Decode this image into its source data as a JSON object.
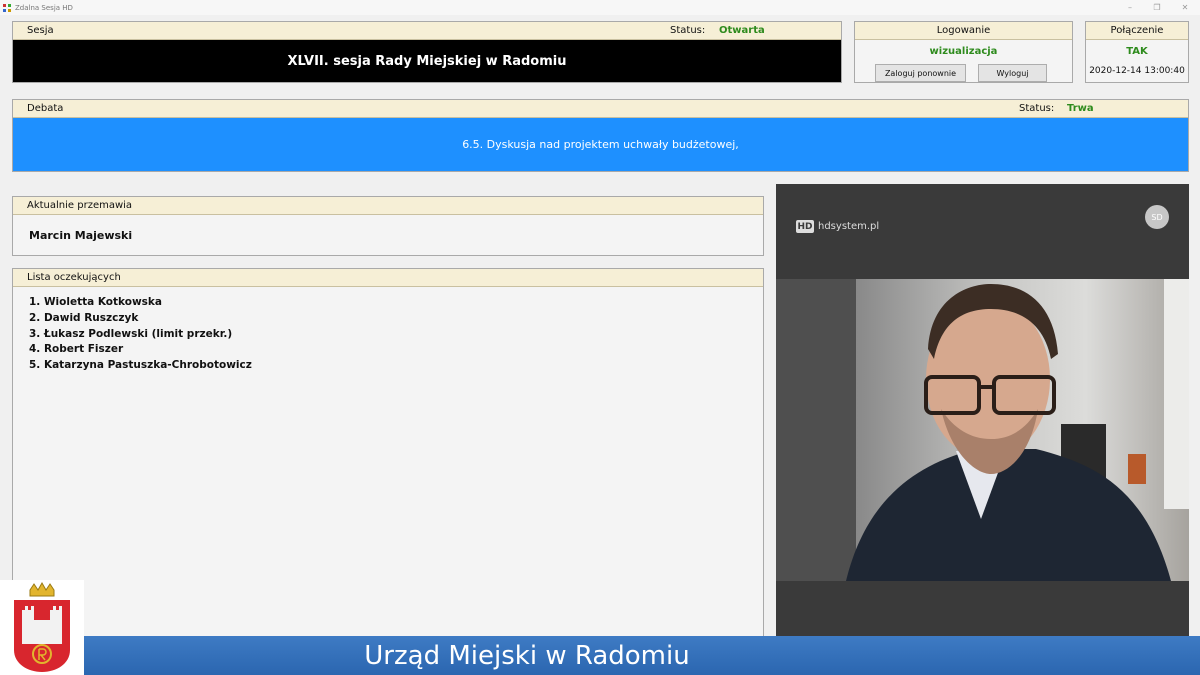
{
  "window": {
    "title": "Zdalna Sesja HD"
  },
  "session": {
    "header_label": "Sesja",
    "status_label": "Status:",
    "status_value": "Otwarta",
    "title": "XLVII. sesja Rady Miejskiej w Radomiu"
  },
  "login": {
    "header_label": "Logowanie",
    "user": "wizualizacja",
    "relogin_label": "Zaloguj ponownie",
    "logout_label": "Wyloguj"
  },
  "connection": {
    "header_label": "Połączenie",
    "state": "TAK",
    "timestamp": "2020-12-14 13:00:40"
  },
  "debate": {
    "header_label": "Debata",
    "status_label": "Status:",
    "status_value": "Trwa",
    "topic": "6.5. Dyskusja nad projektem uchwały budżetowej,"
  },
  "current_speaker": {
    "header_label": "Aktualnie przemawia",
    "name": "Marcin Majewski"
  },
  "queue": {
    "header_label": "Lista oczekujących",
    "items": [
      "1. Wioletta Kotkowska",
      "2. Dawid Ruszczyk",
      "3. Łukasz Podlewski (limit przekr.)",
      "4. Robert Fiszer",
      "5. Katarzyna Pastuszka-Chrobotowicz"
    ]
  },
  "video": {
    "brand": "hdsystem.pl",
    "brand_mark": "HD",
    "avatar_initials": "SD"
  },
  "footer": {
    "text": "Urząd Miejski w Radomiu"
  },
  "colors": {
    "header_bg": "#f6efd6",
    "status_green": "#2e8b1d",
    "debate_blue": "#1e90ff",
    "footer_blue": "#2b66b0"
  }
}
